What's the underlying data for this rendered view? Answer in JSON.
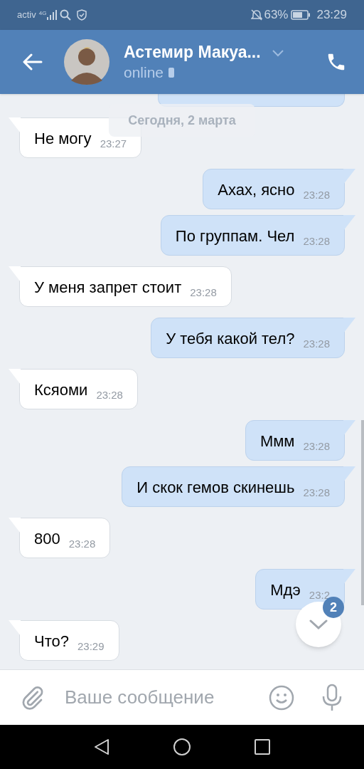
{
  "status_bar": {
    "carrier": "activ",
    "network": "4G",
    "battery": "63%",
    "time": "23:29",
    "muted": true
  },
  "header": {
    "name": "Астемир Макуа...",
    "status": "online"
  },
  "date_label": "Сегодня, 2 марта",
  "messages": [
    {
      "kind": "partial"
    },
    {
      "kind": "incoming",
      "text": "Не могу",
      "time": "23:27"
    },
    {
      "kind": "outgoing",
      "text": "Ахах, ясно",
      "time": "23:28"
    },
    {
      "kind": "outgoing",
      "text": "По группам. Чел",
      "time": "23:28"
    },
    {
      "kind": "incoming",
      "text": "У меня запрет стоит",
      "time": "23:28"
    },
    {
      "kind": "outgoing",
      "text": "У тебя какой тел?",
      "time": "23:28"
    },
    {
      "kind": "incoming",
      "text": "Ксяоми",
      "time": "23:28"
    },
    {
      "kind": "outgoing",
      "text": "Ммм",
      "time": "23:28"
    },
    {
      "kind": "outgoing",
      "text": "И скок гемов скинешь",
      "time": "23:28"
    },
    {
      "kind": "incoming",
      "text": "800",
      "time": "23:28"
    },
    {
      "kind": "outgoing",
      "text": "Мдэ",
      "time": "23:2"
    },
    {
      "kind": "incoming",
      "text": "Что?",
      "time": "23:29"
    }
  ],
  "scroll_button": {
    "badge": "2"
  },
  "composer": {
    "placeholder": "Ваше сообщение"
  }
}
